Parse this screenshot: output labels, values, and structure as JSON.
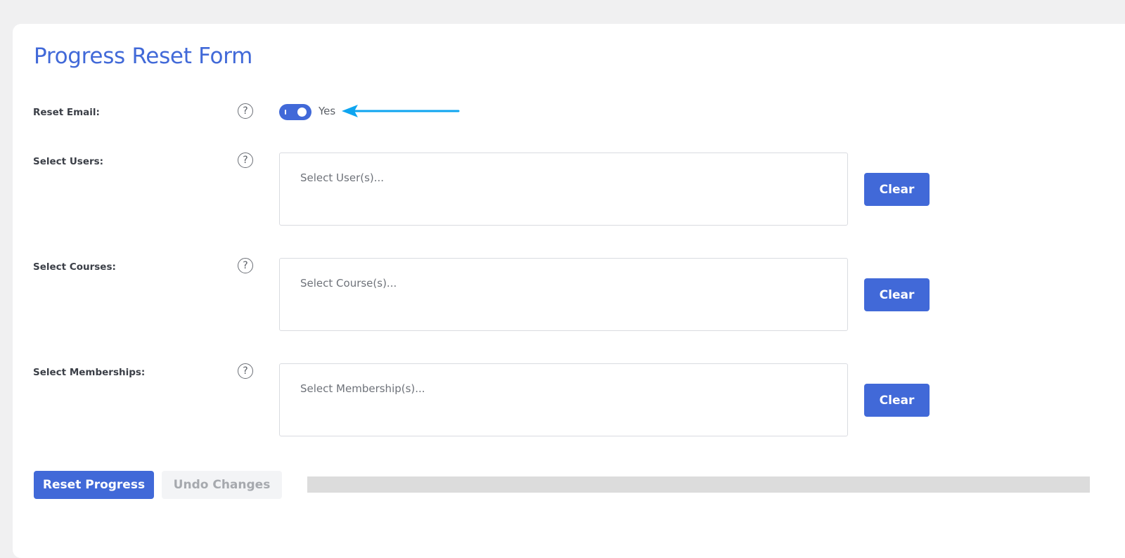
{
  "form": {
    "title": "Progress Reset Form",
    "help_glyph": "?",
    "reset_email": {
      "label": "Reset Email:",
      "toggle_on": true,
      "toggle_text": "Yes"
    },
    "users": {
      "label": "Select Users:",
      "placeholder": "Select User(s)...",
      "clear_label": "Clear"
    },
    "courses": {
      "label": "Select Courses:",
      "placeholder": "Select Course(s)...",
      "clear_label": "Clear"
    },
    "memberships": {
      "label": "Select Memberships:",
      "placeholder": "Select Membership(s)...",
      "clear_label": "Clear"
    }
  },
  "actions": {
    "reset_label": "Reset Progress",
    "undo_label": "Undo Changes",
    "undo_disabled": true
  },
  "progress": {
    "fraction": 0
  },
  "colors": {
    "accent": "#4169d8",
    "annotation_arrow": "#0ea5f0",
    "page_bg": "#f0f0f1",
    "progress_track": "#dcdcdc"
  },
  "icons": {
    "help": "question-circle-icon",
    "annotation": "arrow-left-icon"
  }
}
